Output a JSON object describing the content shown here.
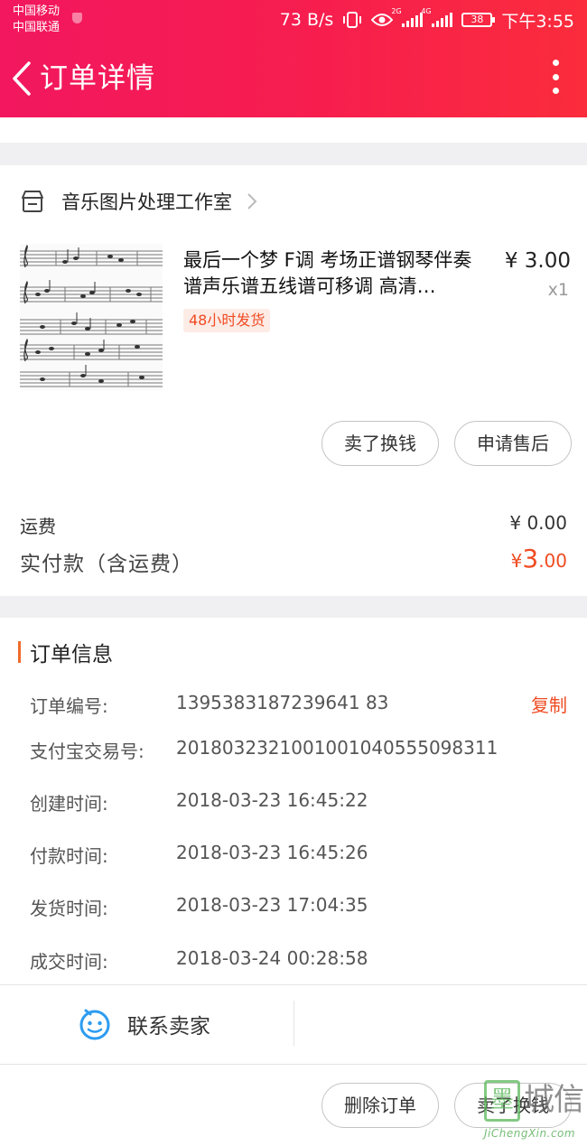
{
  "status_bar": {
    "carrier_1": "中国移动",
    "carrier_2": "中国联通",
    "net_speed": "73 B/s",
    "signal_1_type": "2G",
    "signal_2_type": "4G",
    "battery": "38",
    "time": "下午3:55"
  },
  "nav": {
    "title": "订单详情",
    "back_icon": "chevron-left-icon",
    "more_icon": "more-vertical-icon"
  },
  "shop": {
    "name": "音乐图片处理工作室",
    "icon": "store-icon"
  },
  "product": {
    "title": "最后一个梦 F调 考场正谱钢琴伴奏谱声乐谱五线谱可移调 高清…",
    "tag": "48小时发货",
    "price": "¥ 3.00",
    "quantity": "x1"
  },
  "item_actions": {
    "sell": "卖了换钱",
    "after_sale": "申请售后"
  },
  "summary": {
    "shipping_label": "运费",
    "shipping_value": "¥ 0.00",
    "paid_label": "实付款（含运费）",
    "paid_currency": "¥",
    "paid_integer": "3",
    "paid_decimal": ".00"
  },
  "order_info": {
    "title": "订单信息",
    "copy_label": "复制",
    "rows": [
      {
        "label": "订单编号:",
        "value": "1395383187239641 83"
      },
      {
        "label": "支付宝交易号:",
        "value": "2018032321001001040555098311"
      },
      {
        "label": "创建时间:",
        "value": "2018-03-23 16:45:22"
      },
      {
        "label": "付款时间:",
        "value": "2018-03-23 16:45:26"
      },
      {
        "label": "发货时间:",
        "value": "2018-03-23 17:04:35"
      },
      {
        "label": "成交时间:",
        "value": "2018-03-24 00:28:58"
      }
    ]
  },
  "contact": {
    "label": "联系卖家",
    "icon": "chat-face-icon"
  },
  "bottom_actions": {
    "delete": "删除订单",
    "sell": "卖了换钱"
  },
  "watermark": {
    "logo_char": "墨",
    "text": "城信",
    "domain": "JiChengXin.com"
  },
  "colors": {
    "header_start": "#f2175f",
    "header_end": "#fb2c3c",
    "accent_orange": "#f04b22",
    "contact_icon": "#2c9cf0"
  }
}
